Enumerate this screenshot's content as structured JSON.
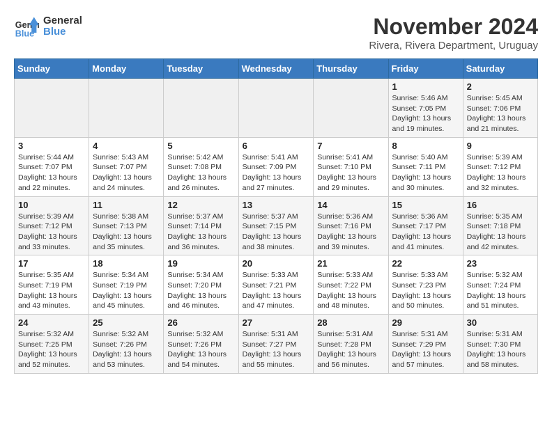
{
  "logo": {
    "line1": "General",
    "line2": "Blue"
  },
  "title": "November 2024",
  "location": "Rivera, Rivera Department, Uruguay",
  "weekdays": [
    "Sunday",
    "Monday",
    "Tuesday",
    "Wednesday",
    "Thursday",
    "Friday",
    "Saturday"
  ],
  "weeks": [
    [
      {
        "day": "",
        "info": ""
      },
      {
        "day": "",
        "info": ""
      },
      {
        "day": "",
        "info": ""
      },
      {
        "day": "",
        "info": ""
      },
      {
        "day": "",
        "info": ""
      },
      {
        "day": "1",
        "info": "Sunrise: 5:46 AM\nSunset: 7:05 PM\nDaylight: 13 hours\nand 19 minutes."
      },
      {
        "day": "2",
        "info": "Sunrise: 5:45 AM\nSunset: 7:06 PM\nDaylight: 13 hours\nand 21 minutes."
      }
    ],
    [
      {
        "day": "3",
        "info": "Sunrise: 5:44 AM\nSunset: 7:07 PM\nDaylight: 13 hours\nand 22 minutes."
      },
      {
        "day": "4",
        "info": "Sunrise: 5:43 AM\nSunset: 7:07 PM\nDaylight: 13 hours\nand 24 minutes."
      },
      {
        "day": "5",
        "info": "Sunrise: 5:42 AM\nSunset: 7:08 PM\nDaylight: 13 hours\nand 26 minutes."
      },
      {
        "day": "6",
        "info": "Sunrise: 5:41 AM\nSunset: 7:09 PM\nDaylight: 13 hours\nand 27 minutes."
      },
      {
        "day": "7",
        "info": "Sunrise: 5:41 AM\nSunset: 7:10 PM\nDaylight: 13 hours\nand 29 minutes."
      },
      {
        "day": "8",
        "info": "Sunrise: 5:40 AM\nSunset: 7:11 PM\nDaylight: 13 hours\nand 30 minutes."
      },
      {
        "day": "9",
        "info": "Sunrise: 5:39 AM\nSunset: 7:12 PM\nDaylight: 13 hours\nand 32 minutes."
      }
    ],
    [
      {
        "day": "10",
        "info": "Sunrise: 5:39 AM\nSunset: 7:12 PM\nDaylight: 13 hours\nand 33 minutes."
      },
      {
        "day": "11",
        "info": "Sunrise: 5:38 AM\nSunset: 7:13 PM\nDaylight: 13 hours\nand 35 minutes."
      },
      {
        "day": "12",
        "info": "Sunrise: 5:37 AM\nSunset: 7:14 PM\nDaylight: 13 hours\nand 36 minutes."
      },
      {
        "day": "13",
        "info": "Sunrise: 5:37 AM\nSunset: 7:15 PM\nDaylight: 13 hours\nand 38 minutes."
      },
      {
        "day": "14",
        "info": "Sunrise: 5:36 AM\nSunset: 7:16 PM\nDaylight: 13 hours\nand 39 minutes."
      },
      {
        "day": "15",
        "info": "Sunrise: 5:36 AM\nSunset: 7:17 PM\nDaylight: 13 hours\nand 41 minutes."
      },
      {
        "day": "16",
        "info": "Sunrise: 5:35 AM\nSunset: 7:18 PM\nDaylight: 13 hours\nand 42 minutes."
      }
    ],
    [
      {
        "day": "17",
        "info": "Sunrise: 5:35 AM\nSunset: 7:19 PM\nDaylight: 13 hours\nand 43 minutes."
      },
      {
        "day": "18",
        "info": "Sunrise: 5:34 AM\nSunset: 7:19 PM\nDaylight: 13 hours\nand 45 minutes."
      },
      {
        "day": "19",
        "info": "Sunrise: 5:34 AM\nSunset: 7:20 PM\nDaylight: 13 hours\nand 46 minutes."
      },
      {
        "day": "20",
        "info": "Sunrise: 5:33 AM\nSunset: 7:21 PM\nDaylight: 13 hours\nand 47 minutes."
      },
      {
        "day": "21",
        "info": "Sunrise: 5:33 AM\nSunset: 7:22 PM\nDaylight: 13 hours\nand 48 minutes."
      },
      {
        "day": "22",
        "info": "Sunrise: 5:33 AM\nSunset: 7:23 PM\nDaylight: 13 hours\nand 50 minutes."
      },
      {
        "day": "23",
        "info": "Sunrise: 5:32 AM\nSunset: 7:24 PM\nDaylight: 13 hours\nand 51 minutes."
      }
    ],
    [
      {
        "day": "24",
        "info": "Sunrise: 5:32 AM\nSunset: 7:25 PM\nDaylight: 13 hours\nand 52 minutes."
      },
      {
        "day": "25",
        "info": "Sunrise: 5:32 AM\nSunset: 7:26 PM\nDaylight: 13 hours\nand 53 minutes."
      },
      {
        "day": "26",
        "info": "Sunrise: 5:32 AM\nSunset: 7:26 PM\nDaylight: 13 hours\nand 54 minutes."
      },
      {
        "day": "27",
        "info": "Sunrise: 5:31 AM\nSunset: 7:27 PM\nDaylight: 13 hours\nand 55 minutes."
      },
      {
        "day": "28",
        "info": "Sunrise: 5:31 AM\nSunset: 7:28 PM\nDaylight: 13 hours\nand 56 minutes."
      },
      {
        "day": "29",
        "info": "Sunrise: 5:31 AM\nSunset: 7:29 PM\nDaylight: 13 hours\nand 57 minutes."
      },
      {
        "day": "30",
        "info": "Sunrise: 5:31 AM\nSunset: 7:30 PM\nDaylight: 13 hours\nand 58 minutes."
      }
    ]
  ]
}
